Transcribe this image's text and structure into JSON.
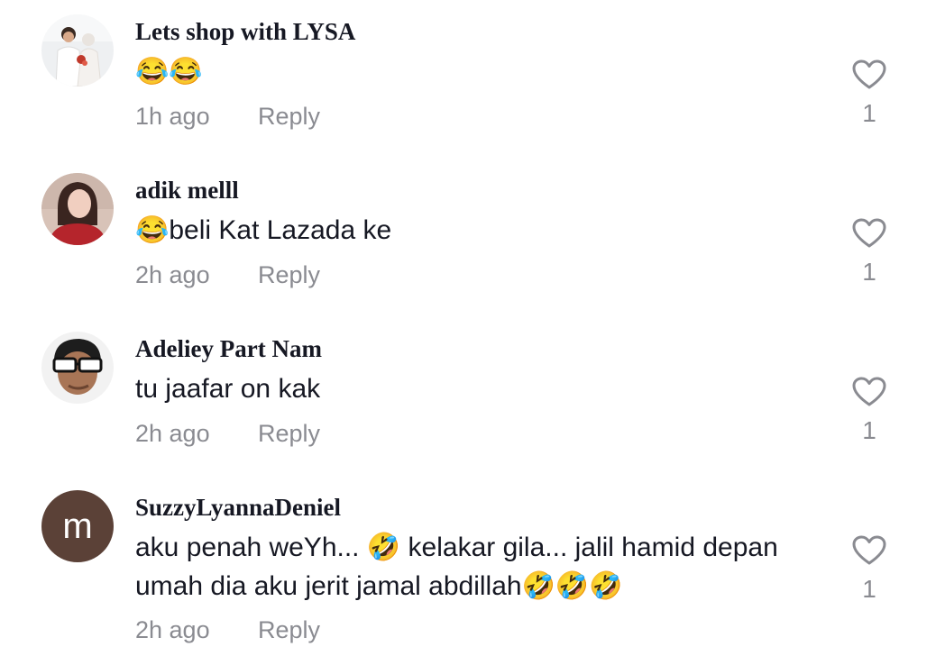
{
  "comments": [
    {
      "username": "Lets shop with LYSA",
      "text": "😂😂",
      "time": "1h ago",
      "reply_label": "Reply",
      "likes": "1"
    },
    {
      "username": "adik melll",
      "text": "😂beli Kat Lazada ke",
      "time": "2h ago",
      "reply_label": "Reply",
      "likes": "1"
    },
    {
      "username": "Adeliey Part Nam",
      "text": "tu jaafar on kak",
      "time": "2h ago",
      "reply_label": "Reply",
      "likes": "1"
    },
    {
      "username": "SuzzyLyannaDeniel",
      "text": "aku penah weYh... 🤣 kelakar gila... jalil hamid depan umah dia aku jerit jamal abdillah🤣🤣🤣",
      "time": "2h ago",
      "reply_label": "Reply",
      "likes": "1",
      "avatar_letter": "m"
    }
  ],
  "icons": {
    "like": "heart-outline-icon"
  },
  "colors": {
    "secondary_text": "#8a8b91",
    "primary_text": "#161823",
    "letter_avatar_bg": "#5b4137"
  }
}
